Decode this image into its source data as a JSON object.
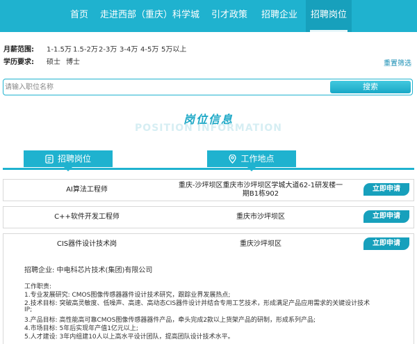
{
  "nav": {
    "items": [
      {
        "label": "首页"
      },
      {
        "label": "走进西部（重庆）科学城"
      },
      {
        "label": "引才政策"
      },
      {
        "label": "招聘企业"
      },
      {
        "label": "招聘岗位"
      }
    ],
    "active_index": 4
  },
  "filters": {
    "salary": {
      "label": "月薪范围:",
      "options": [
        "1-1.5万",
        "1.5-2万",
        "2-3万",
        "3-4万",
        "4-5万",
        "5万以上"
      ]
    },
    "education": {
      "label": "学历要求:",
      "options": [
        "硕士",
        "博士"
      ]
    },
    "reset_label": "重置筛选"
  },
  "search": {
    "placeholder": "请输入职位名称",
    "button_label": "搜索"
  },
  "section": {
    "title": "岗位信息",
    "subtitle": "POSITION INFORMATION"
  },
  "columns": {
    "position": "招聘岗位",
    "location": "工作地点"
  },
  "jobs": [
    {
      "title": "AI算法工程师",
      "location": "重庆-沙坪坝区重庆市沙坪坝区学城大道62-1研发楼一期B1栋902",
      "apply_label": "立即申请"
    },
    {
      "title": "C++软件开发工程师",
      "location": "重庆市沙坪坝区",
      "apply_label": "立即申请"
    },
    {
      "title": "CIS器件设计技术岗",
      "location": "重庆沙坪坝区",
      "apply_label": "立即申请"
    }
  ],
  "details": {
    "company_line": "招聘企业: 中电科芯片技术(集团)有限公司",
    "duties_heading": "工作职责:",
    "duties": [
      "1.专业发展研究: CMOS图像传感器器件设计技术研究，跟踪业界发展热点;",
      "2.技术目标: 突破高灵敏度、低噪声、高速、高动态CIS器件设计并结合专用工艺技术，形成满足产品应用需求的关键设计技术",
      "IP;",
      "3.产品目标: 高性能高可靠CMOS图像传感器器件产品，牵头完成2款以上货架产品的研制，形成系列产品;",
      "4.市场目标: 5年后实现年产值1亿元以上;",
      "5.人才建设: 3年内组建10人以上高水平设计团队，提高团队设计技术水平。"
    ]
  },
  "colors": {
    "accent": "#1fb2cf",
    "accent_dark": "#17a0bc"
  }
}
